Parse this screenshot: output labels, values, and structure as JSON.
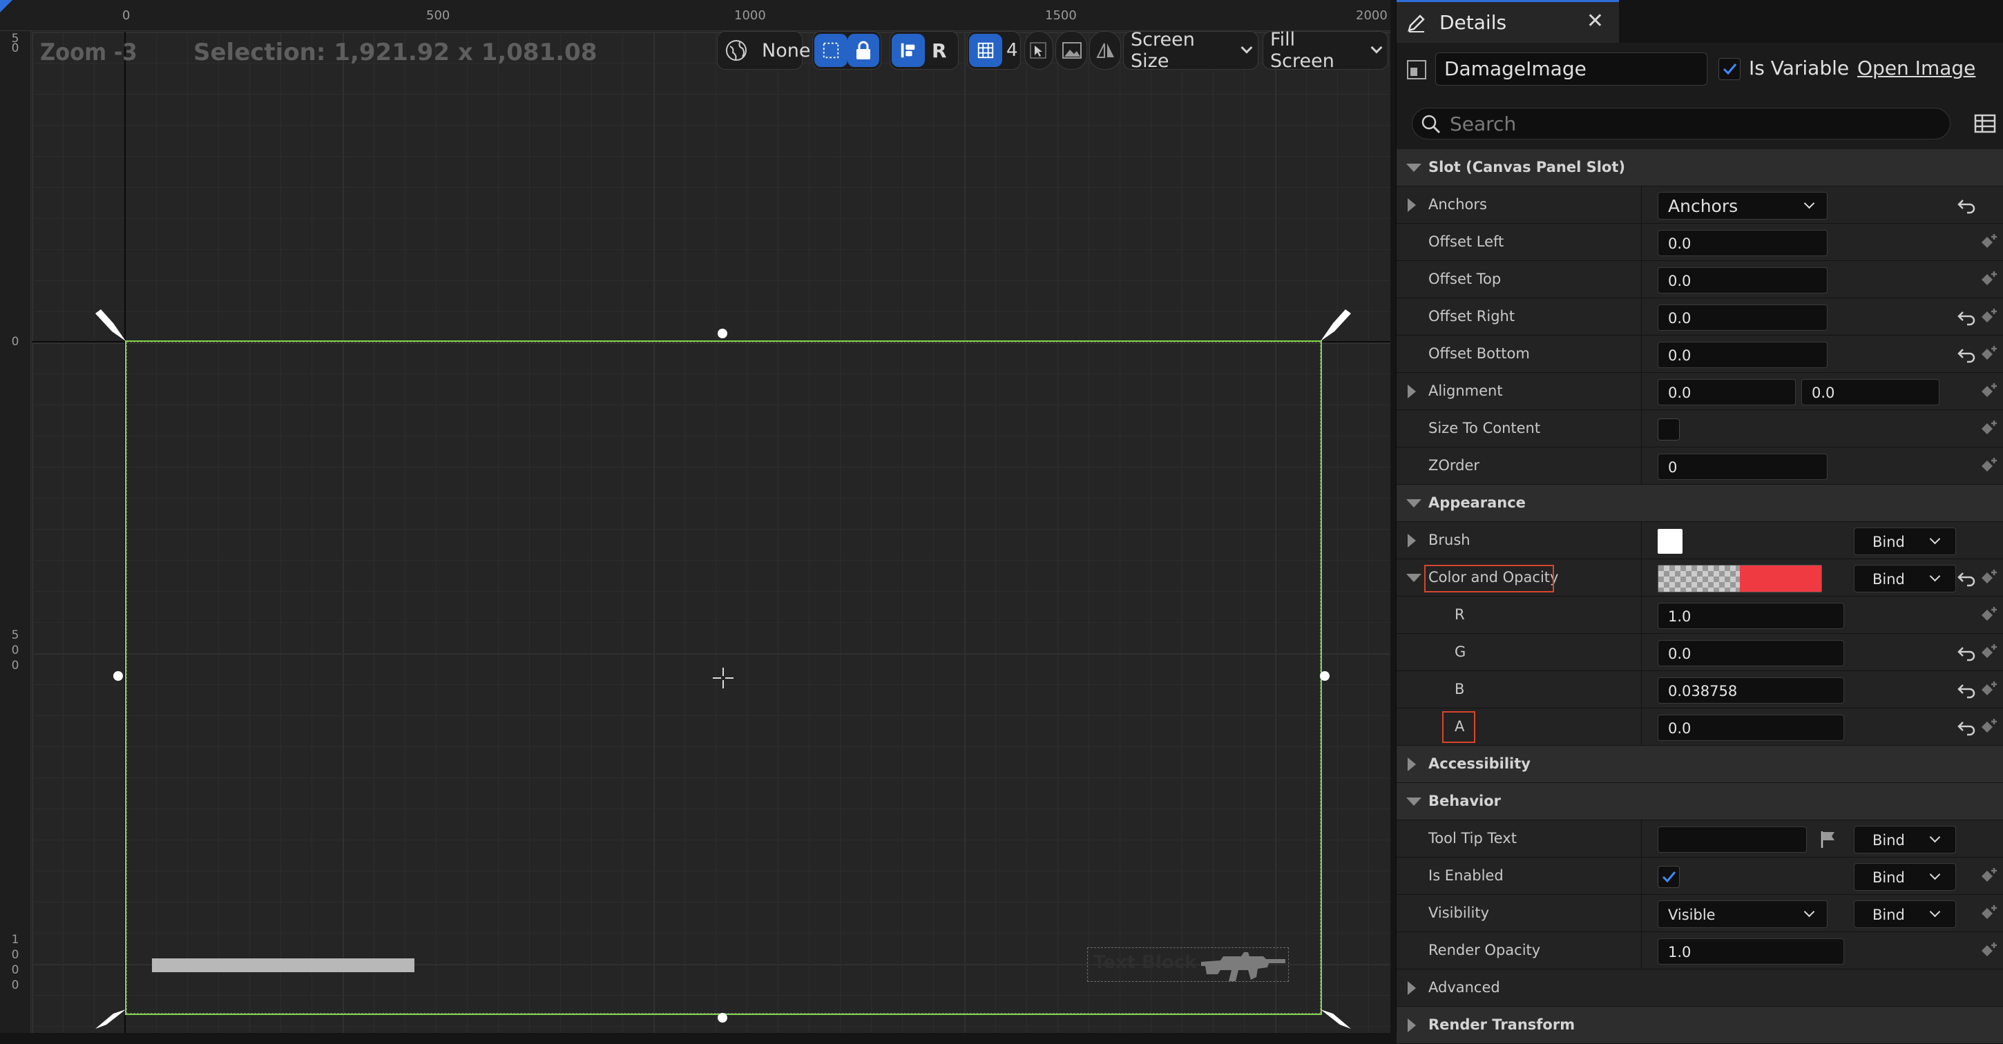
{
  "designer": {
    "zoom": "Zoom -3",
    "selection": "Selection: 1,921.92 x 1,081.08",
    "ruler_top": [
      "0",
      "500",
      "1000",
      "1500",
      "2000"
    ],
    "ruler_left_zero": "0",
    "ruler_left_500": [
      "5",
      "0",
      "0"
    ],
    "ruler_left_1000": [
      "1",
      "0",
      "0",
      "0"
    ],
    "ruler_left_top": [
      "5",
      "0"
    ],
    "toolbar": {
      "world_label": "None",
      "r_label": "R",
      "grid_snap": "4",
      "screen_size": "Screen Size",
      "fill_screen": "Fill Screen"
    },
    "ammo_text": "Text Block"
  },
  "details": {
    "tab_title": "Details",
    "close_glyph": "✕",
    "widget_name": "DamageImage",
    "is_variable_label": "Is Variable",
    "open_image_label": "Open Image",
    "search_placeholder": "Search",
    "slot_category": "Slot (Canvas Panel Slot)",
    "anchors_label": "Anchors",
    "anchors_value": "Anchors",
    "offset_left_label": "Offset Left",
    "offset_left_value": "0.0",
    "offset_top_label": "Offset Top",
    "offset_top_value": "0.0",
    "offset_right_label": "Offset Right",
    "offset_right_value": "0.0",
    "offset_bottom_label": "Offset Bottom",
    "offset_bottom_value": "0.0",
    "alignment_label": "Alignment",
    "alignment_x": "0.0",
    "alignment_y": "0.0",
    "size_to_content_label": "Size To Content",
    "zorder_label": "ZOrder",
    "zorder_value": "0",
    "appearance_category": "Appearance",
    "brush_label": "Brush",
    "bind_label": "Bind",
    "color_opacity_label": "Color and Opacity",
    "r_label": "R",
    "r_value": "1.0",
    "g_label": "G",
    "g_value": "0.0",
    "b_label": "B",
    "b_value": "0.038758",
    "a_label": "A",
    "a_value": "0.0",
    "accessibility_category": "Accessibility",
    "behavior_category": "Behavior",
    "tooltip_label": "Tool Tip Text",
    "tooltip_value": "",
    "is_enabled_label": "Is Enabled",
    "visibility_label": "Visibility",
    "visibility_value": "Visible",
    "render_opacity_label": "Render Opacity",
    "render_opacity_value": "1.0",
    "advanced_category": "Advanced",
    "render_transform_category": "Render Transform"
  },
  "colors": {
    "accent_blue": "#2563c7",
    "selection_green": "#7fd44a",
    "highlight_red": "#d9452b",
    "color_swatch": "#f03a42"
  }
}
